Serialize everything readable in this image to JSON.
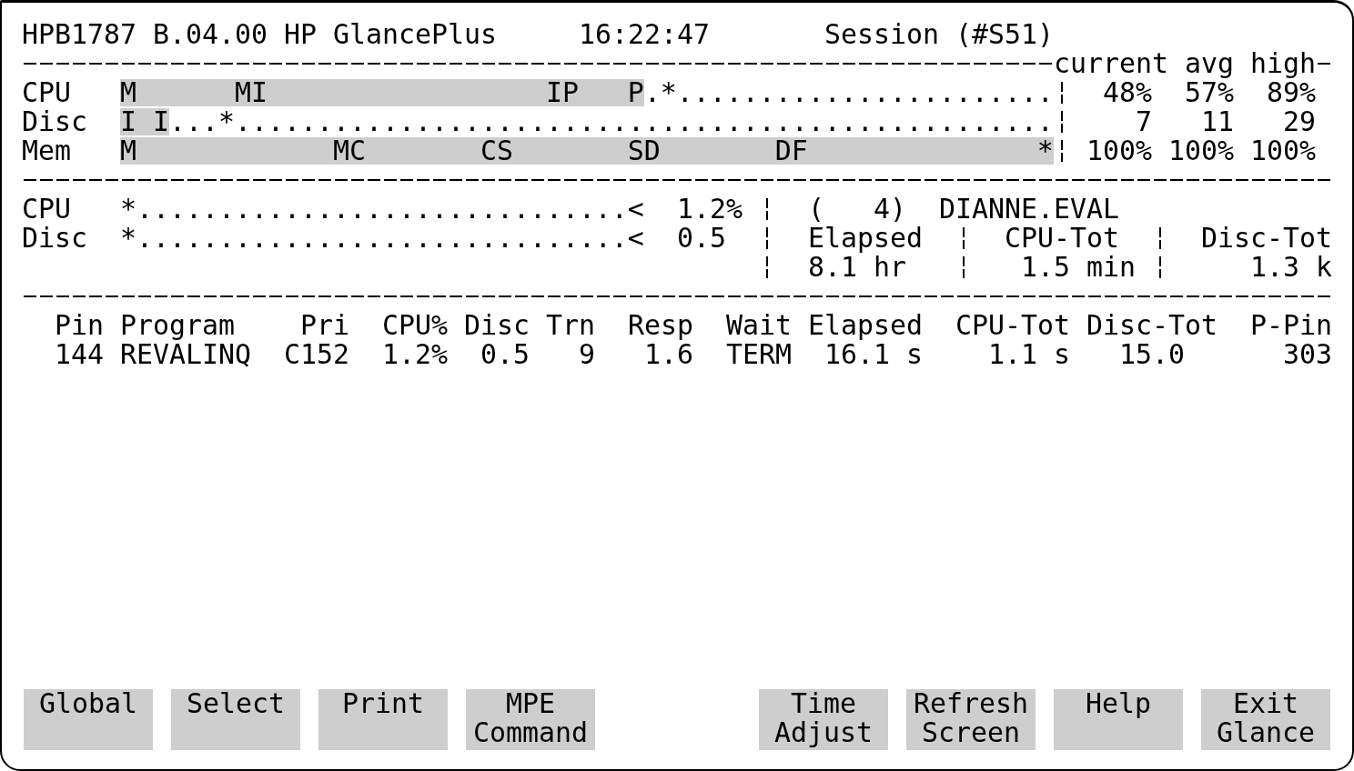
{
  "header": {
    "system": "HPB1787 B.04.00 HP GlancePlus",
    "time": "16:22:47",
    "session": "Session (#S51)"
  },
  "global_usage": {
    "columns": [
      "current",
      "avg",
      "high"
    ],
    "rows": [
      {
        "label": "CPU",
        "bar_segments": [
          {
            "text": "M      MI                 IP   P",
            "shaded": true
          },
          {
            "text": ".*.......................",
            "shaded": false
          }
        ],
        "values": [
          "48%",
          "57%",
          "89%"
        ]
      },
      {
        "label": "Disc",
        "bar_segments": [
          {
            "text": "I I",
            "shaded": true
          },
          {
            "text": "...*..................................................",
            "shaded": false
          }
        ],
        "values": [
          "7",
          "11",
          "29"
        ]
      },
      {
        "label": "Mem",
        "bar_segments": [
          {
            "text": "M            MC       CS       SD       DF              *",
            "shaded": true
          }
        ],
        "values": [
          "100%",
          "100%",
          "100%"
        ]
      }
    ]
  },
  "process_usage": {
    "rows": [
      {
        "label": "CPU",
        "bar": "*..............................<",
        "value": "1.2%"
      },
      {
        "label": "Disc",
        "bar": "*..............................<",
        "value": "0.5"
      }
    ]
  },
  "process_info": {
    "number": "(   4)",
    "name": "DIANNE.EVAL",
    "stats": [
      {
        "label": "Elapsed",
        "value": "8.1 hr"
      },
      {
        "label": "CPU-Tot",
        "value": "1.5 min"
      },
      {
        "label": "Disc-Tot",
        "value": "1.3 k"
      }
    ]
  },
  "process_table": {
    "columns": [
      "Pin",
      "Program",
      "Pri",
      "CPU%",
      "Disc",
      "Trn",
      "Resp",
      "Wait",
      "Elapsed",
      "CPU-Tot",
      "Disc-Tot",
      "P-Pin"
    ],
    "rows": [
      [
        "144",
        "REVALINQ",
        "C152",
        "1.2%",
        "0.5",
        "9",
        "1.6",
        "TERM",
        "16.1 s",
        "1.1 s",
        "15.0",
        "303"
      ]
    ]
  },
  "function_key_groups": [
    {
      "keys": [
        {
          "lines": [
            "Global"
          ]
        },
        {
          "lines": [
            "Select"
          ]
        },
        {
          "lines": [
            "Print"
          ]
        },
        {
          "lines": [
            "MPE",
            "Command"
          ]
        }
      ]
    },
    {
      "keys": [
        {
          "lines": [
            "Time",
            "Adjust"
          ]
        },
        {
          "lines": [
            "Refresh",
            "Screen"
          ]
        },
        {
          "lines": [
            "Help"
          ]
        },
        {
          "lines": [
            "Exit",
            "Glance"
          ]
        }
      ]
    }
  ]
}
